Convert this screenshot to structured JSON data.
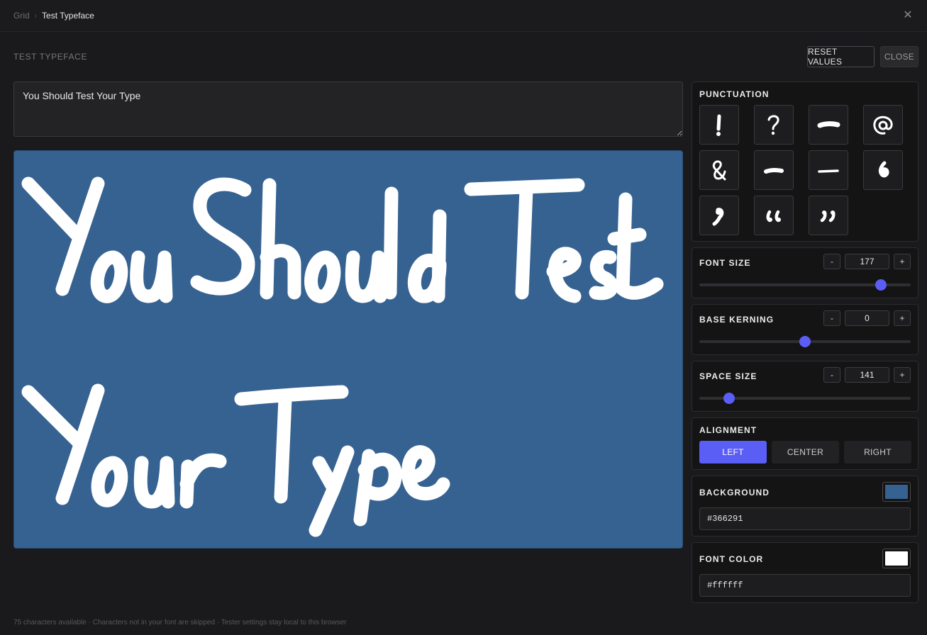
{
  "breadcrumb": {
    "root": "Grid",
    "separator": "›",
    "current": "Test Typeface"
  },
  "header": {
    "title": "TEST TYPEFACE",
    "reset_label": "RESET VALUES",
    "close_label": "CLOSE"
  },
  "tester": {
    "text_value": "You Should Test Your Type",
    "preview_lines": [
      "You Should Test",
      "Your Type"
    ],
    "preview_background": "#366291",
    "preview_font_color": "#ffffff"
  },
  "punctuation": {
    "title": "PUNCTUATION",
    "glyphs": [
      "!",
      "?",
      "–",
      "@",
      "&",
      "-",
      "—",
      "‘",
      "’",
      "“",
      "”"
    ]
  },
  "font_size": {
    "label": "FONT SIZE",
    "value": "177",
    "minus": "-",
    "plus": "+",
    "level": 0.86
  },
  "base_kerning": {
    "label": "BASE KERNING",
    "value": "0",
    "minus": "-",
    "plus": "+",
    "level": 0.5
  },
  "space_size": {
    "label": "SPACE SIZE",
    "value": "141",
    "minus": "-",
    "plus": "+",
    "level": 0.14
  },
  "alignment": {
    "label": "ALIGNMENT",
    "options": [
      "LEFT",
      "CENTER",
      "RIGHT"
    ],
    "selected": "LEFT"
  },
  "background": {
    "label": "BACKGROUND",
    "value": "#366291"
  },
  "font_color": {
    "label": "FONT COLOR",
    "value": "#ffffff"
  },
  "colors": {
    "accent": "#5b5ef5",
    "panel_bg": "#141415",
    "page_bg": "#1a1a1c"
  },
  "footer": {
    "text": "75 characters available · Characters not in your font are skipped · Tester settings stay local to this browser"
  }
}
